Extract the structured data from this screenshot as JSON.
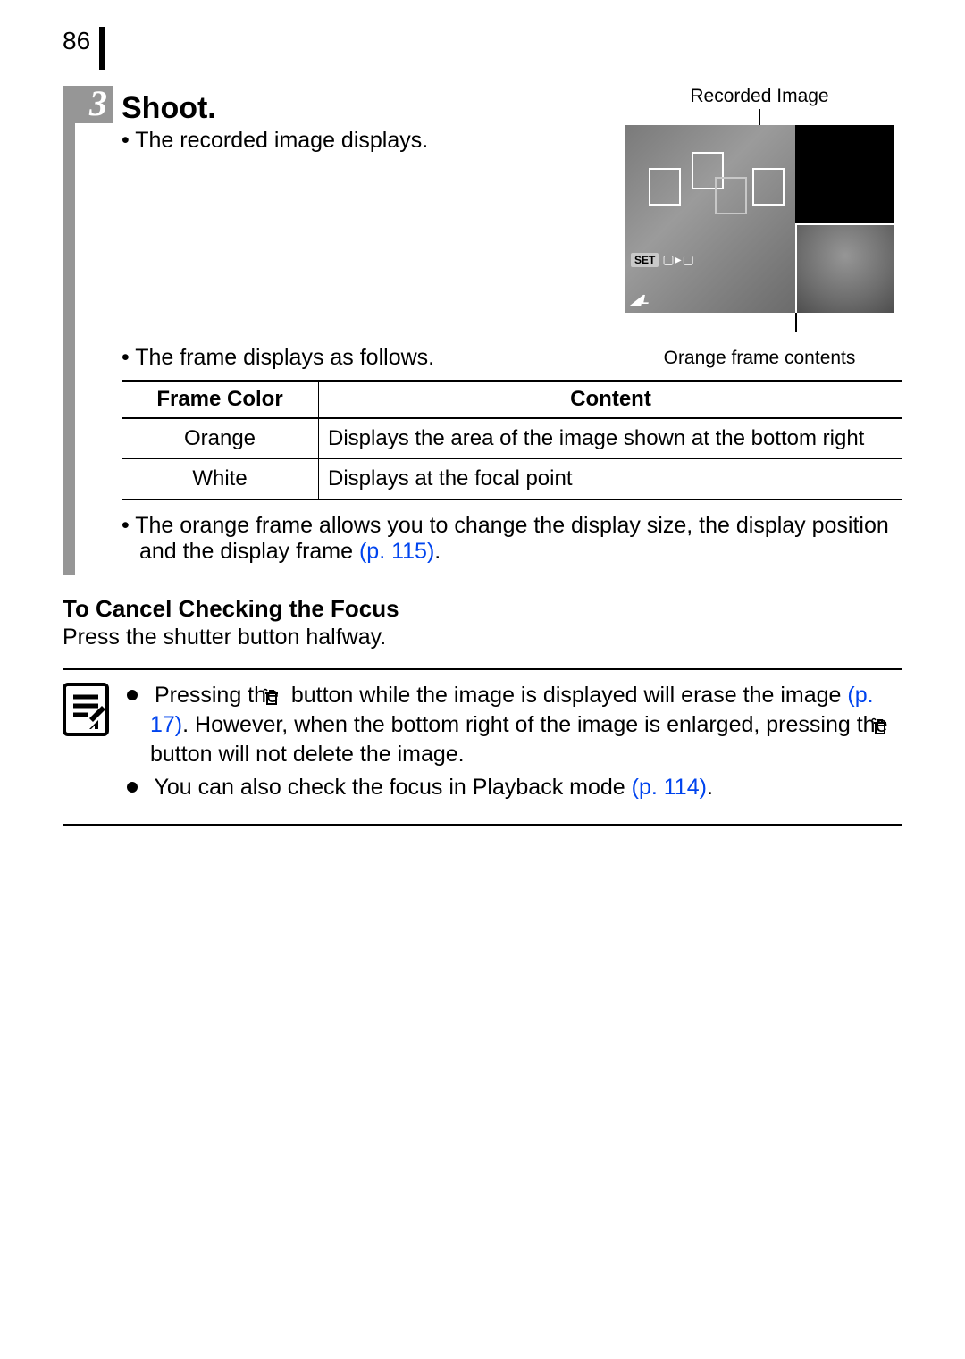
{
  "page_number": "86",
  "step": {
    "number": "3",
    "title": "Shoot.",
    "bullet1": "The recorded image displays.",
    "img_label_top": "Recorded Image",
    "img_label_bottom": "Orange frame contents",
    "lcd": {
      "set_text": "SET",
      "quality_text": "L"
    },
    "bullet2": "The frame displays as follows.",
    "table": {
      "head": {
        "col1": "Frame Color",
        "col2": "Content"
      },
      "rows": [
        {
          "color": "Orange",
          "content": "Displays the area of the image shown at the bottom right"
        },
        {
          "color": "White",
          "content": "Displays at the focal point"
        }
      ]
    },
    "bullet3_a": "The orange frame allows you to change the display size, the display position and the display frame ",
    "bullet3_link": "(p. 115)",
    "bullet3_b": "."
  },
  "cancel": {
    "heading": "To Cancel Checking the Focus",
    "text": "Press the shutter button halfway."
  },
  "note": {
    "p1_a": "Pressing the ",
    "p1_b": " button while the image is displayed will erase the image ",
    "p1_link1": "(p. 17)",
    "p1_c": ". However, when the bottom right of the image is enlarged, pressing the ",
    "p1_d": " button will not delete the image.",
    "p2_a": "You can also check the focus in Playback mode ",
    "p2_link": "(p. 114)",
    "p2_b": "."
  }
}
